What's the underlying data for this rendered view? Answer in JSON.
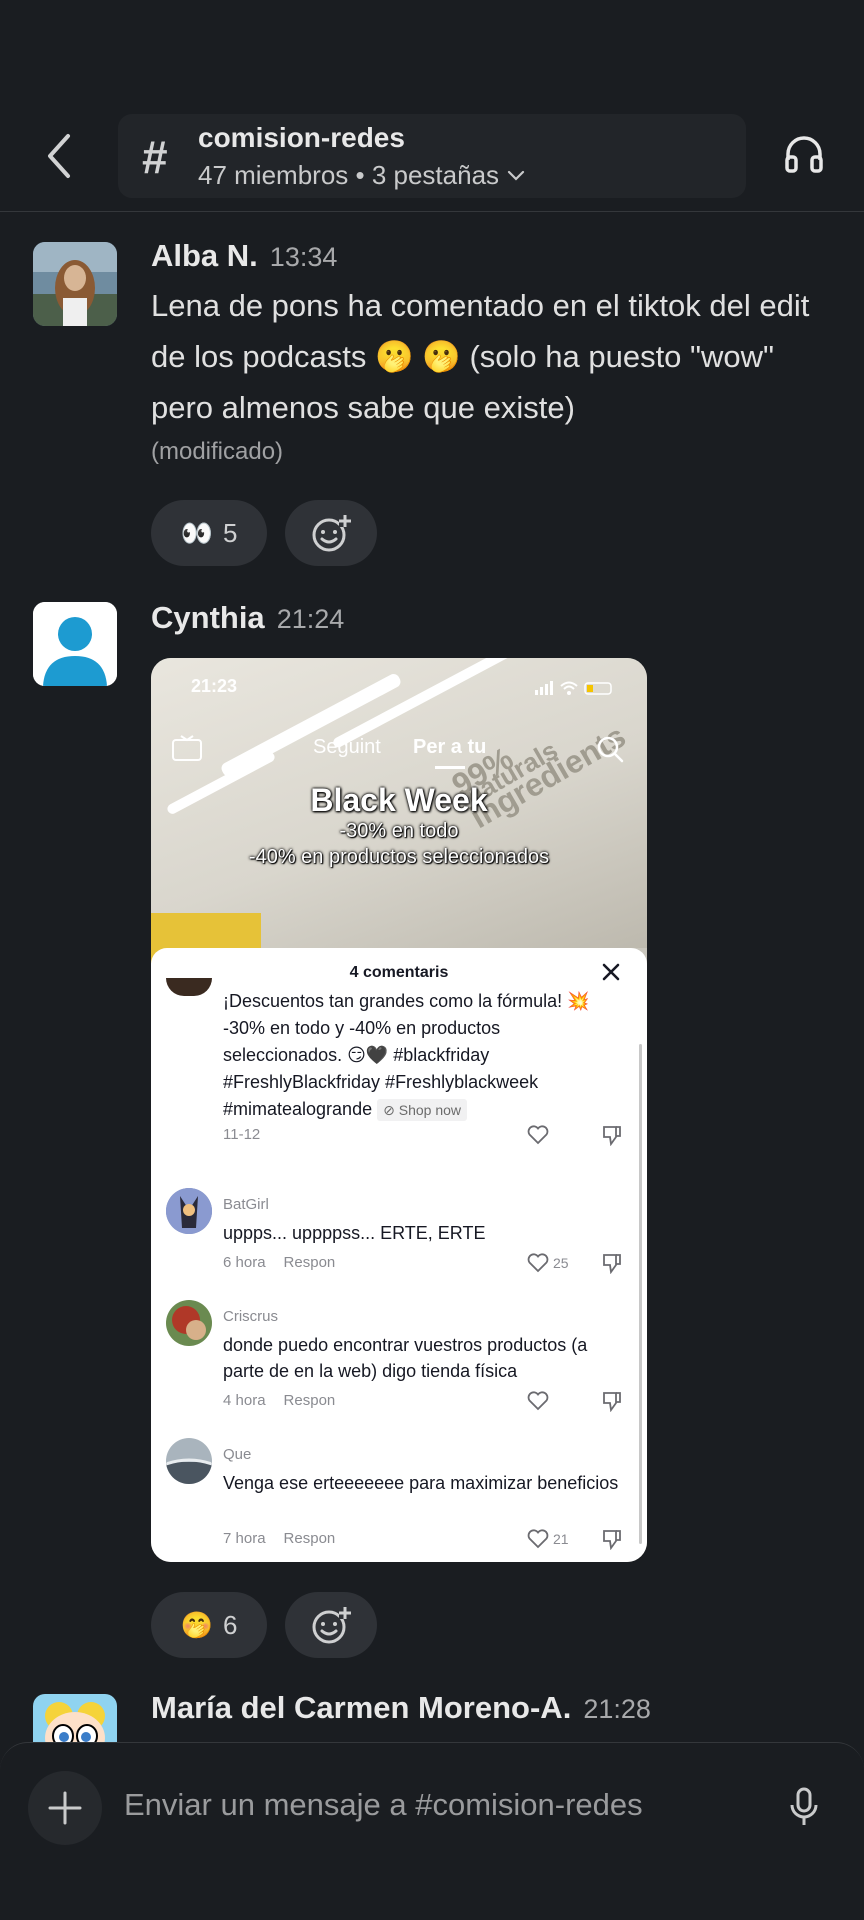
{
  "header": {
    "channel_name": "comision-redes",
    "channel_meta": "47 miembros • 3 pestañas"
  },
  "messages": [
    {
      "author": "Alba N.",
      "time": "13:34",
      "text": "Lena de pons ha comentado en el tiktok del edit de los podcasts 🫢 🫢  (solo ha puesto \"wow\" pero almenos sabe que existe)",
      "edited": "(modificado)",
      "reaction_emoji": "👀",
      "reaction_count": "5"
    },
    {
      "author": "Cynthia",
      "time": "21:24",
      "reaction_emoji": "🤭",
      "reaction_count": "6"
    },
    {
      "author": "María del Carmen Moreno-A.",
      "time": "21:28"
    }
  ],
  "tiktok": {
    "status_time": "21:23",
    "nav_following": "Seguint",
    "nav_foryou": "Per a tu",
    "live_label": "LIVE",
    "promo_title": "Black Week",
    "promo_line1": "-30% en todo",
    "promo_line2": "-40% en productos seleccionados",
    "comments_title": "4 comentaris",
    "caption": "¡Descuentos tan grandes como la fórmula! 💥 -30% en todo y -40% en productos seleccionados. 😏🖤 #blackfriday #FreshlyBlackfriday #Freshlyblackweek #mimatealogrande",
    "shop_now": "Shop now",
    "caption_date": "11-12",
    "reply_label": "Respon",
    "comments": [
      {
        "user": "BatGirl",
        "text": "uppps... uppppss... ERTE, ERTE",
        "age": "6 hora",
        "likes": "25"
      },
      {
        "user": "Criscrus",
        "text": "donde puedo encontrar vuestros productos (a parte de en la web) digo tienda física",
        "age": "4 hora",
        "likes": ""
      },
      {
        "user": "Que",
        "text": "Venga ese erteeeeeee para maximizar beneficios",
        "age": "7 hora",
        "likes": "21"
      }
    ]
  },
  "composer": {
    "placeholder": "Enviar un mensaje a #comision-redes"
  },
  "colors": {
    "background": "#1a1d21",
    "reaction_bg": "#2f3237",
    "avatar_blue": "#1d9bd1"
  }
}
